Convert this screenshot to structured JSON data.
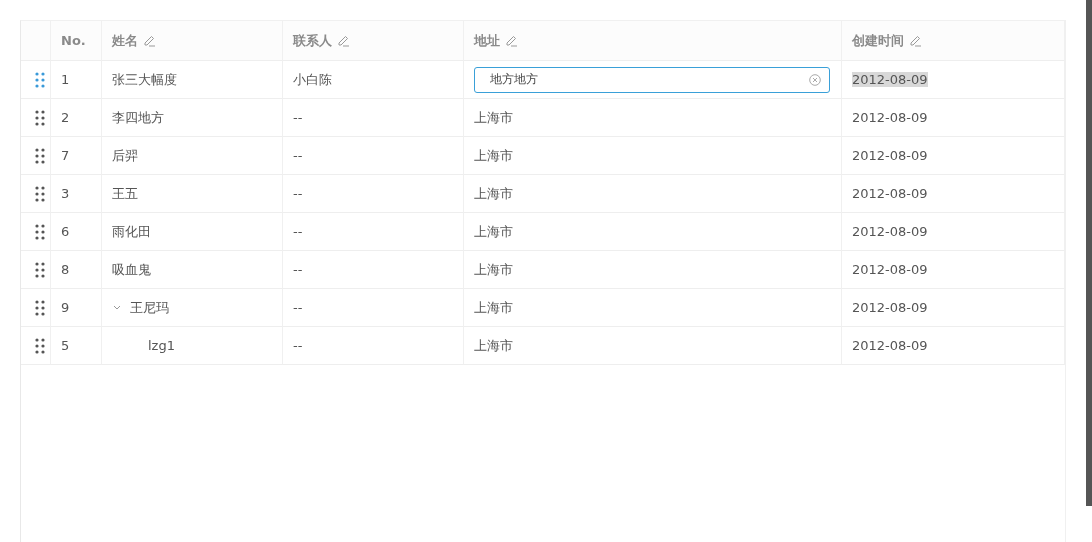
{
  "table": {
    "columns": [
      {
        "label": "No.",
        "editable": false
      },
      {
        "label": "姓名",
        "editable": true
      },
      {
        "label": "联系人",
        "editable": true
      },
      {
        "label": "地址",
        "editable": true
      },
      {
        "label": "创建时间",
        "editable": true
      }
    ],
    "rows": [
      {
        "no": "1",
        "name": "张三大幅度",
        "contact": "小白陈",
        "address": "地方地方",
        "created": "2012-08-09",
        "editing": true,
        "handle_active": true,
        "created_selected": true
      },
      {
        "no": "2",
        "name": "李四地方",
        "contact": "--",
        "address": "上海市",
        "created": "2012-08-09",
        "editing": false,
        "handle_active": false,
        "created_selected": false
      },
      {
        "no": "7",
        "name": "后羿",
        "contact": "--",
        "address": "上海市",
        "created": "2012-08-09",
        "editing": false,
        "handle_active": false,
        "created_selected": false
      },
      {
        "no": "3",
        "name": "王五",
        "contact": "--",
        "address": "上海市",
        "created": "2012-08-09",
        "editing": false,
        "handle_active": false,
        "created_selected": false
      },
      {
        "no": "6",
        "name": "雨化田",
        "contact": "--",
        "address": "上海市",
        "created": "2012-08-09",
        "editing": false,
        "handle_active": false,
        "created_selected": false
      },
      {
        "no": "8",
        "name": "吸血鬼",
        "contact": "--",
        "address": "上海市",
        "created": "2012-08-09",
        "editing": false,
        "handle_active": false,
        "created_selected": false
      },
      {
        "no": "9",
        "name": "王尼玛",
        "contact": "--",
        "address": "上海市",
        "created": "2012-08-09",
        "editing": false,
        "handle_active": false,
        "created_selected": false,
        "expanded": true,
        "children": [
          {
            "no": "5",
            "name": "lzg1",
            "contact": "--",
            "address": "上海市",
            "created": "2012-08-09",
            "editing": false,
            "handle_active": false,
            "created_selected": false
          }
        ]
      }
    ]
  }
}
